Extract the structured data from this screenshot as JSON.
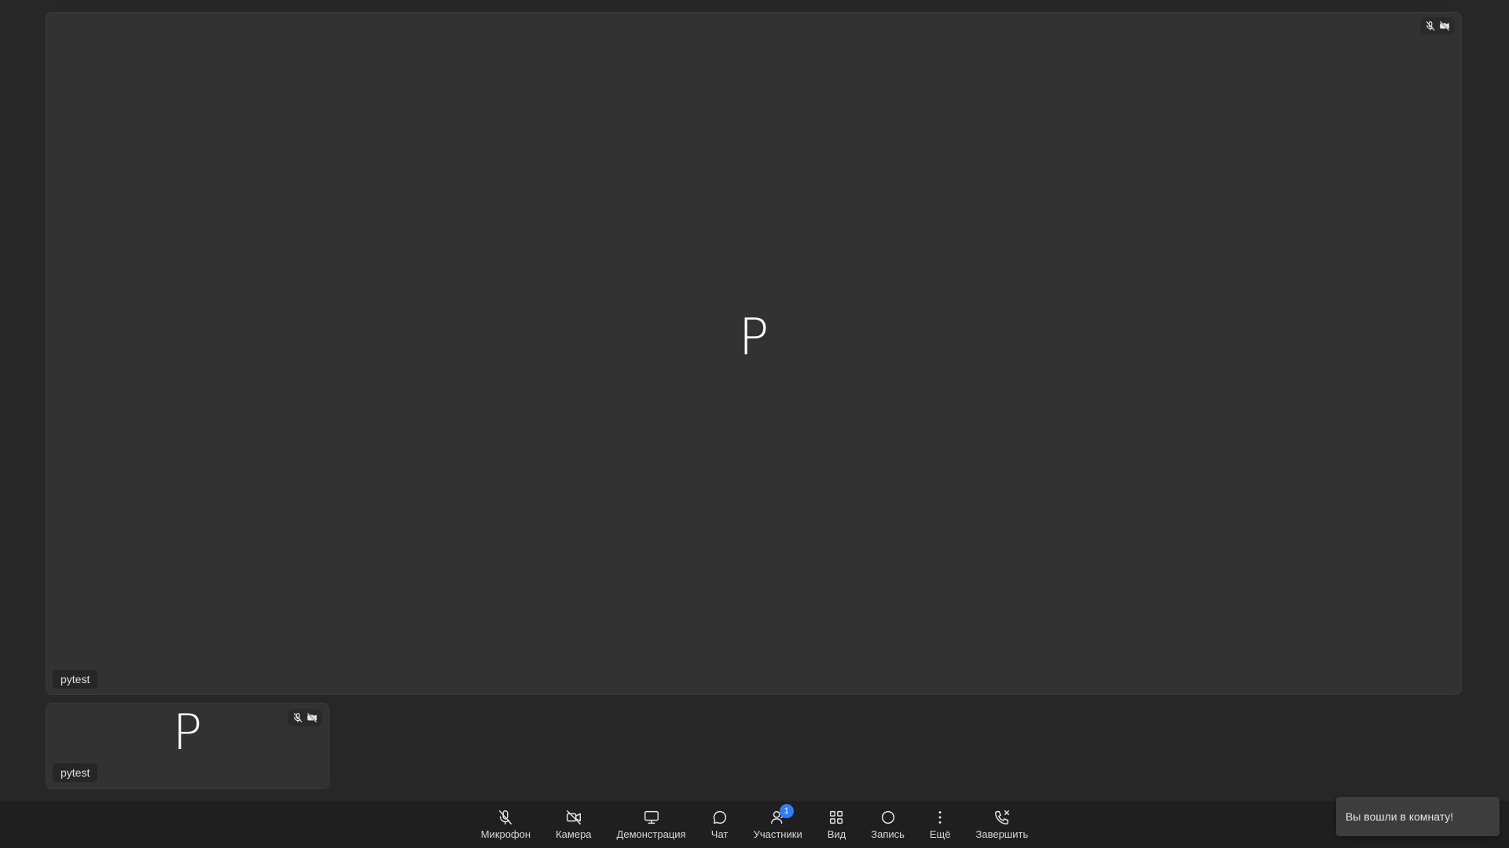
{
  "main_tile": {
    "avatar_letter": "P",
    "participant_name": "pytest",
    "mic_status_icon": "mic-off-icon",
    "camera_status_icon": "camera-off-icon"
  },
  "thumbnail_tile": {
    "avatar_letter": "P",
    "participant_name": "pytest",
    "mic_status_icon": "mic-off-icon",
    "camera_status_icon": "camera-off-icon"
  },
  "toolbar": {
    "microphone_label": "Микрофон",
    "camera_label": "Камера",
    "screen_share_label": "Демонстрация",
    "chat_label": "Чат",
    "participants_label": "Участники",
    "participants_count": "1",
    "view_label": "Вид",
    "record_label": "Запись",
    "more_label": "Ещё",
    "end_call_label": "Завершить"
  },
  "toast": {
    "message": "Вы вошли в комнату!"
  },
  "colors": {
    "background": "#272727",
    "tile": "#323232",
    "toolbar": "#1f1f1f",
    "badge": "#2d7ff9",
    "toast": "#3d3d3d"
  }
}
